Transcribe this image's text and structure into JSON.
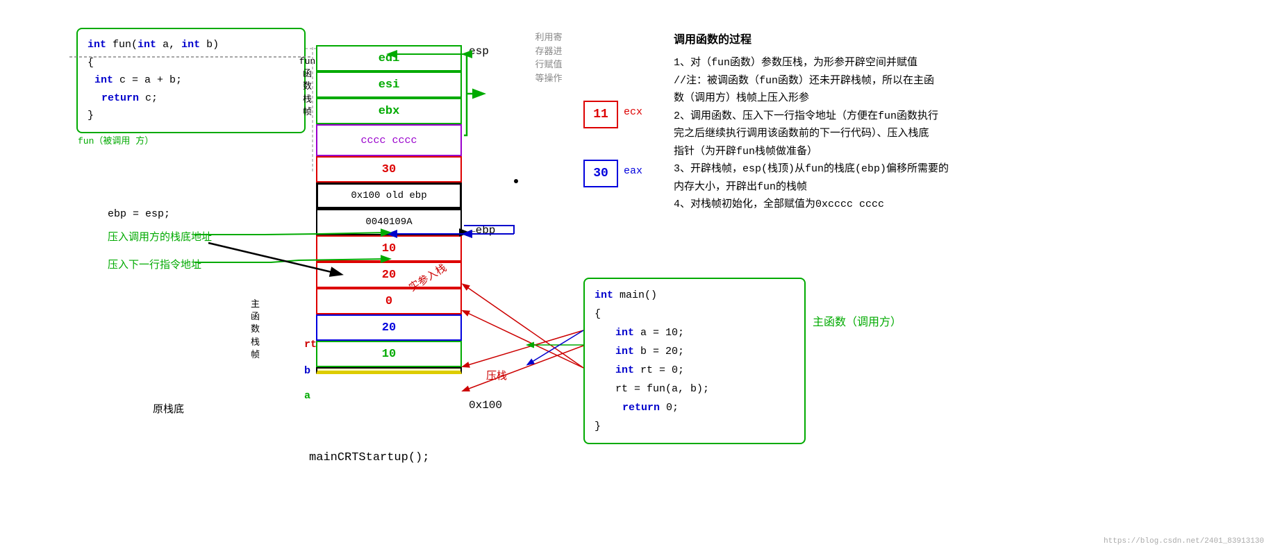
{
  "fun_code": {
    "line1": "int fun(int a,  int b)",
    "line2": "{",
    "line3": "int c = a + b;",
    "line4": "return c;",
    "line5": "}",
    "caller_label": "fun（被调用\n方）"
  },
  "main_code": {
    "line1": "int main()",
    "line2": "{",
    "line3": "int a = 10;",
    "line4": "int b = 20;",
    "line5": "int rt = 0;",
    "line6": "rt = fun(a, b);",
    "line7": "return 0;",
    "line8": "}"
  },
  "stack": {
    "cells": [
      {
        "id": "edi",
        "text": "edi",
        "type": "green-text"
      },
      {
        "id": "esi",
        "text": "esi",
        "type": "green-text"
      },
      {
        "id": "ebx",
        "text": "ebx",
        "type": "green-text"
      },
      {
        "id": "cccc",
        "text": "cccc cccc",
        "type": "purple"
      },
      {
        "id": "30",
        "text": "30",
        "type": "red"
      },
      {
        "id": "old-ebp",
        "text": "0x100  old ebp",
        "type": "black-bold"
      },
      {
        "id": "ret-addr",
        "text": "0040109A",
        "type": "black-text"
      },
      {
        "id": "10-arg",
        "text": "10",
        "type": "red"
      },
      {
        "id": "20-arg",
        "text": "20",
        "type": "red"
      },
      {
        "id": "rt-val",
        "text": "0",
        "type": "red"
      },
      {
        "id": "b-val",
        "text": "20",
        "type": "blue"
      },
      {
        "id": "a-val",
        "text": "10",
        "type": "green"
      },
      {
        "id": "bottom",
        "text": "",
        "type": "yellow-bottom"
      }
    ],
    "labels": {
      "esp": "esp",
      "ebp": "←ebp",
      "ox100": "0x100",
      "fun_frame": "fun\n函\n数\n栈\n帧",
      "main_frame": "主\n函\n数\n栈\n帧",
      "rt": "rt",
      "b": "b",
      "a": "a"
    }
  },
  "registers": {
    "ecx": {
      "value": "11",
      "label": "ecx"
    },
    "eax": {
      "value": "30",
      "label": "eax"
    }
  },
  "annotations": {
    "ebp_esp": "ebp = esp;",
    "push_stack_base": "压入调用方的栈底地址",
    "push_next_instr": "压入下一行指令地址",
    "yuan_zhan_di": "原栈底",
    "maincrt": "mainCRTStartup();",
    "actual_params": "实参入栈",
    "push": "压栈",
    "main_caller": "主函数（调用方）",
    "reg_ops": "利用寄\n存器进\n行赋值\n等操作"
  },
  "description": {
    "title": "调用函数的过程",
    "items": [
      "1、对（fun函数）参数压栈，为形参开辟空间并赋值",
      "//注：被调函数（fun函数）还未开辟栈帧，所以在主函",
      "数（调用方）栈帧上压入形参",
      "2、调用函数、压入下一行指令地址（方便在fun函数执行",
      "完之后继续执行调用该函数前的下一行代码）、压入栈底",
      "指针（为开辟fun栈帧做准备）",
      "3、开辟栈帧，esp(栈顶)从fun的栈底(ebp)偏移所需要的",
      "内存大小，开辟出fun的栈帧",
      "4、对栈帧初始化，全部赋值为0xcccc cccc"
    ]
  },
  "watermark": "https://blog.csdn.net/2401_83913130"
}
